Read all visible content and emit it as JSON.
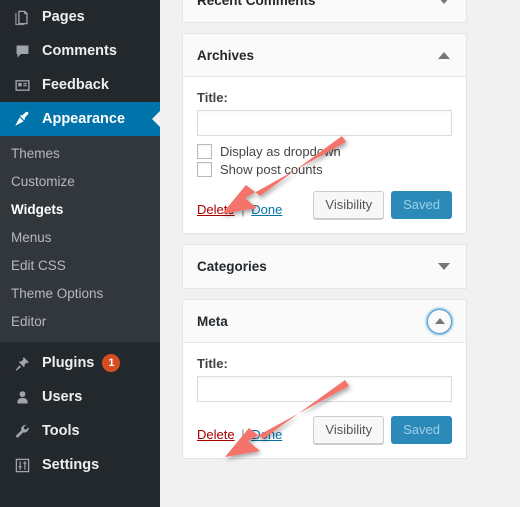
{
  "colors": {
    "sidebar_bg": "#23282d",
    "submenu_bg": "#32373c",
    "accent_blue": "#0073aa",
    "badge_orange": "#d54e21",
    "annotation_arrow": "#f4736a",
    "delete_link": "#aa0000",
    "done_link": "#0073aa",
    "button_primary": "#2b8ab8",
    "panel_bg": "#f1f1f1"
  },
  "sidebar": {
    "top_items": [
      {
        "label": "Pages",
        "icon": "pages-icon",
        "active": false,
        "badge": null
      },
      {
        "label": "Comments",
        "icon": "comments-icon",
        "active": false,
        "badge": null
      },
      {
        "label": "Feedback",
        "icon": "feedback-icon",
        "active": false,
        "badge": null
      },
      {
        "label": "Appearance",
        "icon": "appearance-brush-icon",
        "active": true,
        "badge": null
      }
    ],
    "submenu": [
      {
        "label": "Themes",
        "current": false
      },
      {
        "label": "Customize",
        "current": false
      },
      {
        "label": "Widgets",
        "current": true
      },
      {
        "label": "Menus",
        "current": false
      },
      {
        "label": "Edit CSS",
        "current": false
      },
      {
        "label": "Theme Options",
        "current": false
      },
      {
        "label": "Editor",
        "current": false
      }
    ],
    "bottom_items": [
      {
        "label": "Plugins",
        "icon": "plugins-plug-icon",
        "active": false,
        "badge": "1"
      },
      {
        "label": "Users",
        "icon": "users-person-icon",
        "active": false,
        "badge": null
      },
      {
        "label": "Tools",
        "icon": "tools-wrench-icon",
        "active": false,
        "badge": null
      },
      {
        "label": "Settings",
        "icon": "settings-sliders-icon",
        "active": false,
        "badge": null
      }
    ]
  },
  "widgets": {
    "recent_comments": {
      "title": "Recent Comments",
      "toggle_icon": "chevron-down-icon",
      "expanded": false
    },
    "archives": {
      "title": "Archives",
      "toggle_icon": "chevron-up-icon",
      "expanded": true,
      "title_field": {
        "label": "Title:",
        "value": "",
        "placeholder": ""
      },
      "checkboxes": [
        {
          "label": "Display as dropdown",
          "checked": false
        },
        {
          "label": "Show post counts",
          "checked": false
        }
      ],
      "delete_label": "Delete",
      "separator": "|",
      "done_label": "Done",
      "visibility_label": "Visibility",
      "save_label": "Saved"
    },
    "categories": {
      "title": "Categories",
      "toggle_icon": "chevron-down-icon",
      "expanded": false
    },
    "meta": {
      "title": "Meta",
      "toggle_icon": "chevron-up-icon-circled",
      "expanded": true,
      "focused": true,
      "title_field": {
        "label": "Title:",
        "value": "",
        "placeholder": ""
      },
      "delete_label": "Delete",
      "separator": "|",
      "done_label": "Done",
      "visibility_label": "Visibility",
      "save_label": "Saved"
    }
  },
  "annotations": [
    {
      "name": "arrow-pointing-to-archives-delete",
      "target": "Delete"
    },
    {
      "name": "arrow-pointing-to-meta-delete",
      "target": "Delete"
    }
  ]
}
